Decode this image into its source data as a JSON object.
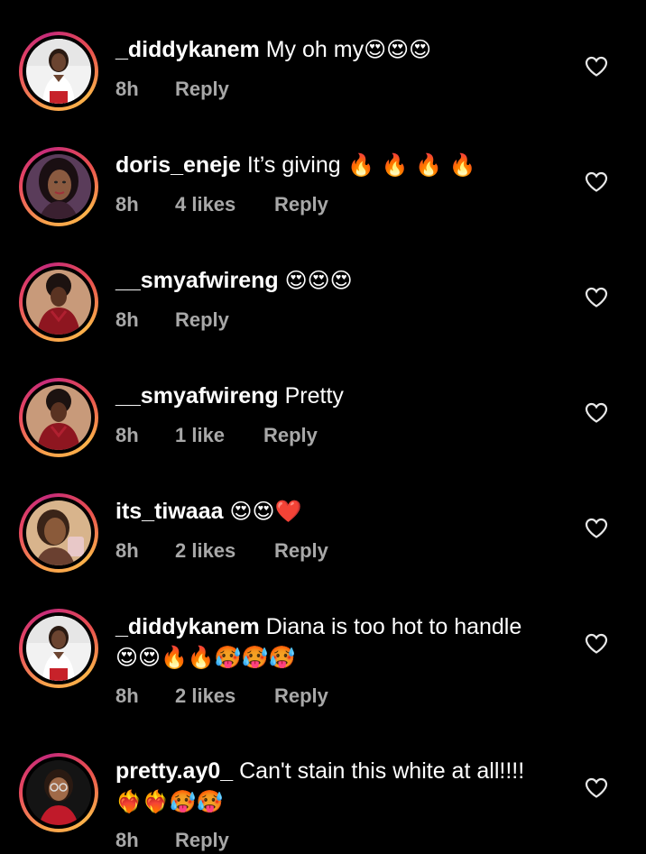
{
  "comments": [
    {
      "username": "_diddykanem",
      "text": "My oh my",
      "emoji": "😍😍😍",
      "extra": "",
      "time": "8h",
      "likes": "",
      "reply": "Reply",
      "avatar": "woman-white-top-icon"
    },
    {
      "username": "doris_eneje",
      "text": "It’s giving",
      "emoji": " 🔥 🔥 🔥 🔥",
      "extra": "",
      "time": "8h",
      "likes": "4 likes",
      "reply": "Reply",
      "avatar": "woman-portrait-icon"
    },
    {
      "username": "__smyafwireng",
      "text": "",
      "emoji": "😍😍😍",
      "extra": "",
      "time": "8h",
      "likes": "",
      "reply": "Reply",
      "avatar": "woman-red-dress-icon"
    },
    {
      "username": "__smyafwireng",
      "text": "Pretty",
      "emoji": "",
      "extra": "",
      "time": "8h",
      "likes": "1 like",
      "reply": "Reply",
      "avatar": "woman-red-dress-icon"
    },
    {
      "username": "its_tiwaaa",
      "text": "",
      "emoji": "😍😍❤️",
      "extra": "",
      "time": "8h",
      "likes": "2 likes",
      "reply": "Reply",
      "avatar": "woman-selfie-icon"
    },
    {
      "username": "_diddykanem",
      "text": "Diana is too hot to handle",
      "emoji": "",
      "extra": "😍😍🔥🔥🥵🥵🥵",
      "time": "8h",
      "likes": "2 likes",
      "reply": "Reply",
      "avatar": "woman-white-top-icon"
    },
    {
      "username": "pretty.ay0_",
      "text": "Can't stain this white at all!!!!",
      "emoji": "",
      "extra": "❤️‍🔥❤️‍🔥🥵🥵",
      "time": "8h",
      "likes": "",
      "reply": "Reply",
      "avatar": "woman-glasses-icon"
    }
  ],
  "colors": {
    "background": "#000000",
    "meta": "#a8a8a8",
    "ring_start": "#f9a24b",
    "ring_end": "#c62b7a"
  }
}
